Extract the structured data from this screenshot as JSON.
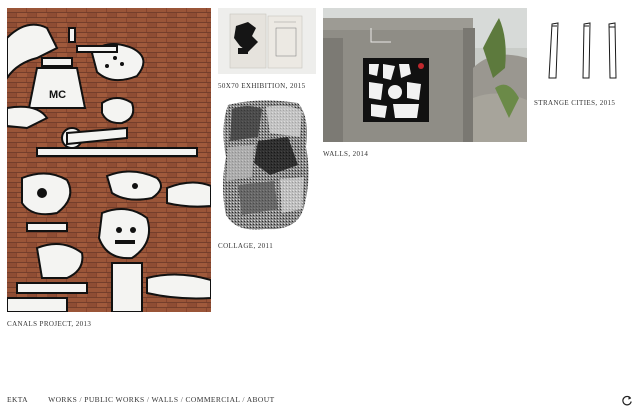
{
  "brand": "EKTA",
  "nav": [
    {
      "label": "WORKS"
    },
    {
      "label": "PUBLIC WORKS"
    },
    {
      "label": "WALLS"
    },
    {
      "label": "COMMERCIAL"
    },
    {
      "label": "ABOUT"
    }
  ],
  "nav_separator": " / ",
  "works": [
    {
      "caption": "CANALS PROJECT, 2013"
    },
    {
      "caption": "50X70 EXHIBITION, 2015"
    },
    {
      "caption": "COLLAGE, 2011"
    },
    {
      "caption": "WALLS, 2014"
    },
    {
      "caption": "STRANGE CITIES, 2015"
    }
  ],
  "icons": {
    "reload": "reload-icon"
  },
  "colors": {
    "background": "#ffffff",
    "text": "#333333",
    "brick": "#8a4a32",
    "concrete": "#8d8b84"
  }
}
